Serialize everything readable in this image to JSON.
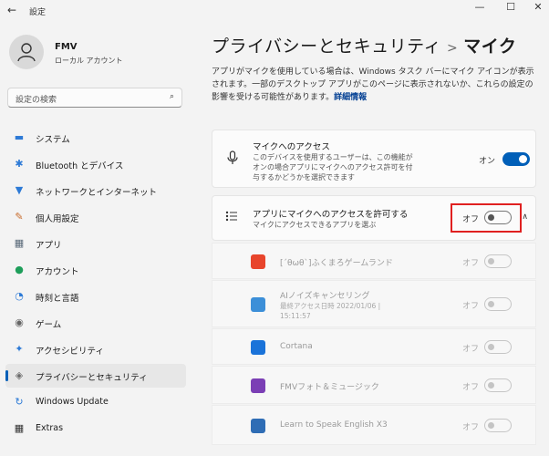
{
  "window": {
    "title": "設定",
    "back": "←",
    "minimize": "—",
    "maximize": "☐",
    "close": "✕"
  },
  "user": {
    "name": "FMV",
    "type": "ローカル アカウント"
  },
  "search": {
    "placeholder": "設定の検索",
    "icon": "⌕"
  },
  "sidebar": {
    "items": [
      {
        "label": "システム",
        "icon": "▬",
        "color": "#2d7ad6"
      },
      {
        "label": "Bluetooth とデバイス",
        "icon": "✱",
        "color": "#2d7ad6"
      },
      {
        "label": "ネットワークとインターネット",
        "icon": "▼",
        "color": "#2d7ad6"
      },
      {
        "label": "個人用設定",
        "icon": "✎",
        "color": "#c86a2a"
      },
      {
        "label": "アプリ",
        "icon": "▦",
        "color": "#5a6a7a"
      },
      {
        "label": "アカウント",
        "icon": "●",
        "color": "#1e9e5a"
      },
      {
        "label": "時刻と言語",
        "icon": "◔",
        "color": "#2d7ad6"
      },
      {
        "label": "ゲーム",
        "icon": "◉",
        "color": "#666666"
      },
      {
        "label": "アクセシビリティ",
        "icon": "✦",
        "color": "#2d7ad6"
      },
      {
        "label": "プライバシーとセキュリティ",
        "icon": "◈",
        "color": "#6b6b6b",
        "active": true
      },
      {
        "label": "Windows Update",
        "icon": "↻",
        "color": "#2d7ad6"
      },
      {
        "label": "Extras",
        "icon": "▦",
        "color": "#333333"
      }
    ]
  },
  "header": {
    "parent": "プライバシーとセキュリティ",
    "separator": ">",
    "current": "マイク"
  },
  "description": {
    "text": "アプリがマイクを使用している場合は、Windows タスク バーにマイク アイコンが表示されます。一部のデスクトップ アプリがこのページに表示されないか、これらの設定の影響を受ける可能性があります。",
    "link": "詳細情報"
  },
  "mic_access": {
    "title": "マイクへのアクセス",
    "subtitle": "このデバイスを使用するユーザーは、この機能がオンの場合アプリにマイクへのアクセス許可を付与するかどうかを選択できます",
    "state": "オン",
    "on": true
  },
  "app_access": {
    "title": "アプリにマイクへのアクセスを許可する",
    "subtitle": "マイクにアクセスできるアプリを選ぶ",
    "state": "オフ",
    "on": false
  },
  "apps": [
    {
      "name": "[ˊθωθˋ]ふくまろゲームランド",
      "subtitle": "",
      "state": "オフ",
      "icon_color": "#e8452c"
    },
    {
      "name": "AIノイズキャンセリング",
      "subtitle": "最終アクセス日時 2022/01/06 | 15:11:57",
      "state": "オフ",
      "icon_color": "#3c8fd8"
    },
    {
      "name": "Cortana",
      "subtitle": "",
      "state": "オフ",
      "icon_color": "#1a73d9"
    },
    {
      "name": "FMVフォト＆ミュージック",
      "subtitle": "",
      "state": "オフ",
      "icon_color": "#7b3fb5"
    },
    {
      "name": "Learn to Speak English X3",
      "subtitle": "",
      "state": "オフ",
      "icon_color": "#2f6db5"
    }
  ],
  "colors": {
    "accent": "#005fb8",
    "highlight_box": "#e02020",
    "background": "#f3f3f3"
  }
}
